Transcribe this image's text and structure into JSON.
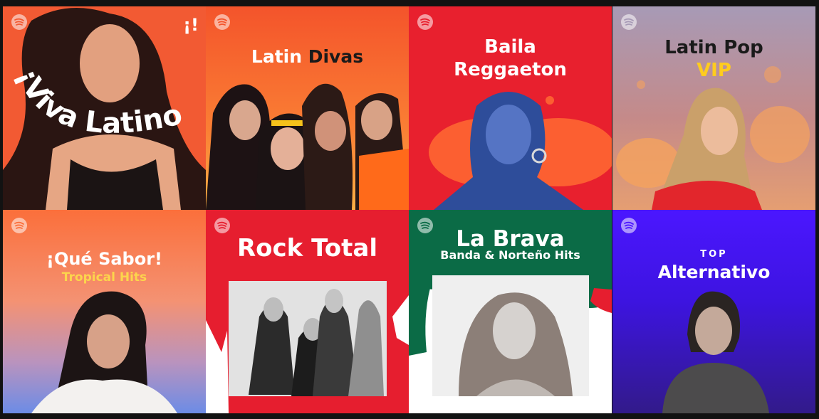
{
  "colors": {
    "background": "#121212",
    "viva": "#f25a33",
    "divas": "#f86a2d",
    "baila": "#e8202e",
    "latinpop": "#b98897",
    "sabor": "#f38763",
    "rock": "#e61e2f",
    "brava_green": "#0b6b46",
    "alternativo": "#3d14e0"
  },
  "playlists": [
    {
      "name_main": "¡Viva Latino!",
      "corner_mark": "¡!",
      "icon": "spotify-logo"
    },
    {
      "name_part1": "Latin ",
      "name_part2": "Divas",
      "icon": "spotify-logo"
    },
    {
      "name_line1": "Baila",
      "name_line2": "Reggaeton",
      "icon": "spotify-logo"
    },
    {
      "name_line1": "Latin Pop",
      "name_line2": "VIP",
      "icon": "spotify-logo"
    },
    {
      "name_line1": "¡Qué Sabor!",
      "name_line2": "Tropical Hits",
      "icon": "spotify-logo"
    },
    {
      "name_line1": "Rock Total",
      "icon": "spotify-logo"
    },
    {
      "name_line1": "La Brava",
      "name_line2": "Banda & Norteño Hits",
      "icon": "spotify-logo"
    },
    {
      "name_line1": "TOP",
      "name_line2": "Alternativo",
      "icon": "spotify-logo"
    }
  ]
}
